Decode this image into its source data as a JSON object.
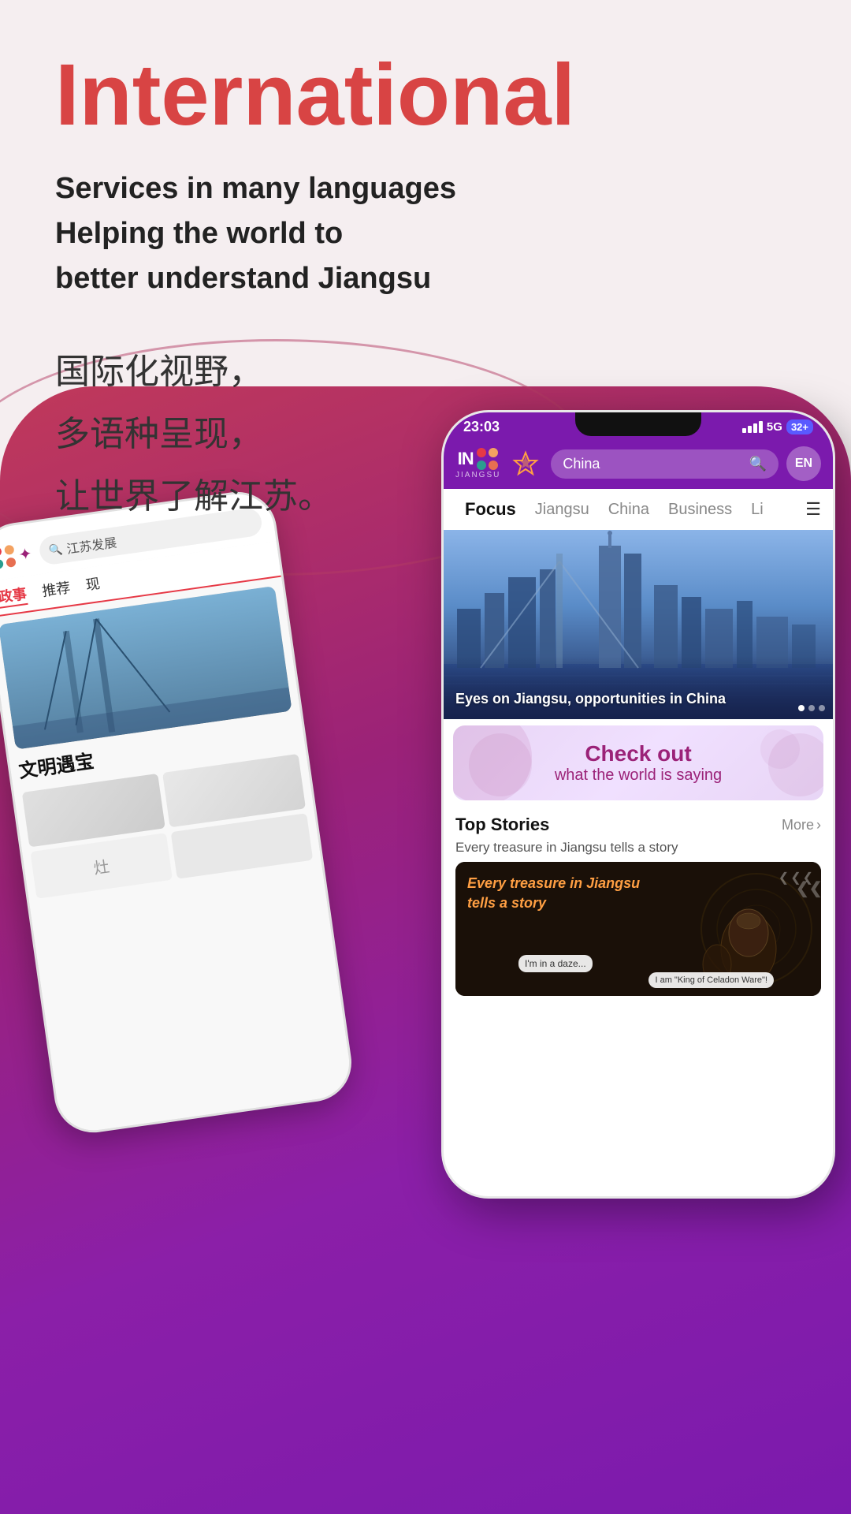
{
  "header": {
    "title_en": "International",
    "subtitle_line1": "Services in many languages",
    "subtitle_line2": "Helping the world to",
    "subtitle_line3": "better understand Jiangsu",
    "zh_line1": "国际化视野，",
    "zh_line2": "多语种呈现，",
    "zh_line3": "让世界了解江苏。"
  },
  "phone_back": {
    "search_placeholder": "江苏发展",
    "nav_recommended": "推荐",
    "nav_current": "现",
    "nav_politics": "政事",
    "caption": "文明遇宝",
    "img_alt": "Bridge silhouette"
  },
  "phone_front": {
    "status_time": "23:03",
    "status_5g": "5G",
    "battery": "32+",
    "logo_text": "JIANGSU",
    "logo_en": "IN",
    "search_text": "China",
    "lang_btn": "EN",
    "nav_focus": "Focus",
    "nav_jiangsu": "Jiangsu",
    "nav_china": "China",
    "nav_business": "Business",
    "nav_li": "Li",
    "hero_caption": "Eyes on Jiangsu, opportunities in China",
    "checkout_title": "Check out",
    "checkout_sub": "what the world is saying",
    "top_stories_title": "Top Stories",
    "top_stories_more": "More",
    "top_stories_subtitle": "Every treasure in Jiangsu tells a story",
    "article_title_line1": "Every treasure in Jiangsu",
    "article_title_line2": "tells a story"
  },
  "colors": {
    "title_red": "#d84444",
    "purple_dark": "#7b1aad",
    "purple_mid": "#9b2278",
    "bg_light": "#f5eef0",
    "bg_curve_start": "#c0395a",
    "bg_curve_end": "#7b1aad"
  }
}
